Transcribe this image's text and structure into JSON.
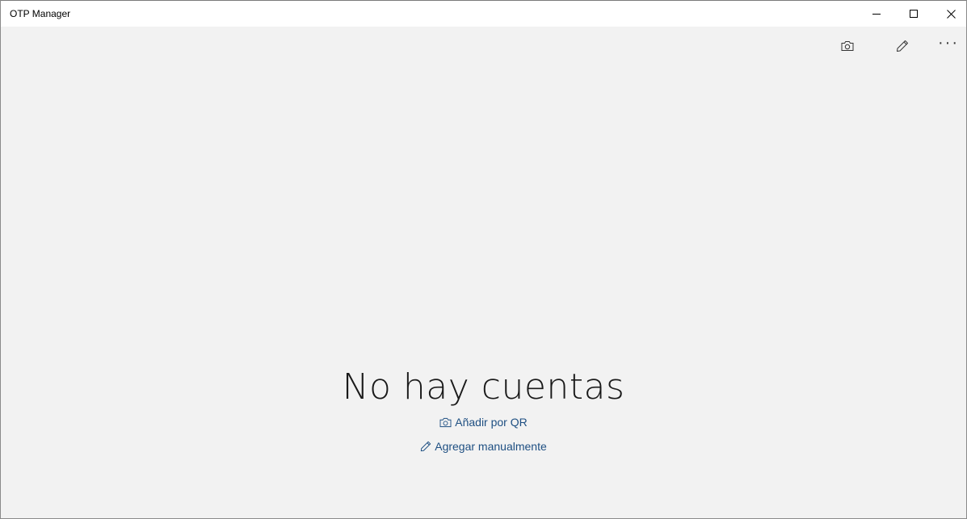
{
  "window": {
    "title": "OTP Manager"
  },
  "caption_buttons": {
    "minimize_icon": "minimize-icon",
    "maximize_icon": "maximize-icon",
    "close_icon": "close-icon"
  },
  "command_bar": {
    "camera_icon": "camera-icon",
    "edit_icon": "pencil-icon",
    "more_icon": "more-icon",
    "more_glyph": "···"
  },
  "empty_state": {
    "title": "No hay cuentas",
    "add_qr_label": "Añadir por QR",
    "add_manual_label": "Agregar manualmente"
  },
  "colors": {
    "background": "#f2f2f2",
    "titlebar": "#ffffff",
    "link": "#1e4f82",
    "text": "#1a1a1a"
  }
}
